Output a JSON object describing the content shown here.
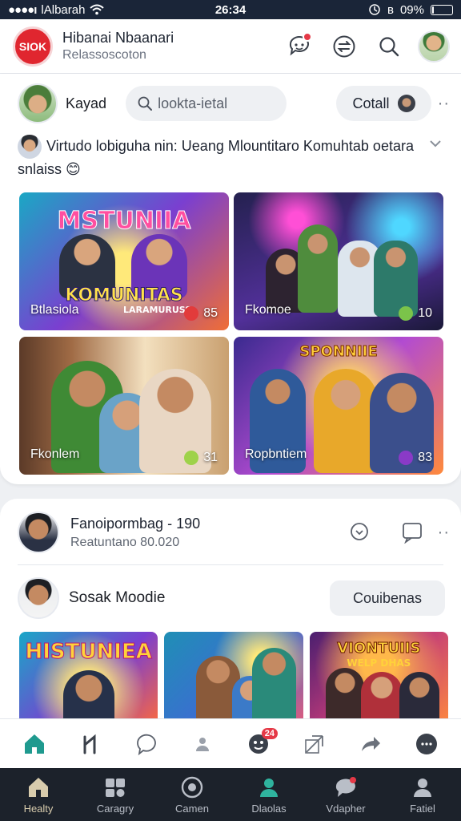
{
  "status_bar": {
    "carrier": "lAlbarah",
    "time": "26:34",
    "battery": "09%",
    "battery_fraction": 0.09
  },
  "app_header": {
    "logo_text": "SIOK",
    "title": "Hibanai Nbaanari",
    "subtitle": "Relassoscoton",
    "icons": [
      "chat-bot-icon",
      "swap-icon",
      "search-icon"
    ]
  },
  "composer": {
    "user_name": "Kayad",
    "search_placeholder": "lookta-ietal",
    "collect_button": "Cotall"
  },
  "post": {
    "title": "Virtudo lobiguha nin: Ueang Mlountitaro Komuhtab oetara snlaiss",
    "emoji": "😊",
    "tiles": [
      {
        "heading": "MSTUNIIA",
        "heading2": "KOMUNITAS",
        "caption": "LARAMURUSS",
        "label": "Btlasiola",
        "count": "85",
        "bubble_color": "#e23b3b"
      },
      {
        "label": "Fkomoe",
        "count": "10",
        "bubble_color": "#7bc34a"
      },
      {
        "label": "Fkonlem",
        "count": "31",
        "bubble_color": "#9ed24a"
      },
      {
        "heading": "SPONNIIE",
        "label": "Ropbntiem",
        "count": "83",
        "bubble_color": "#8a3ac7"
      }
    ]
  },
  "feed_item": {
    "title": "Fanoipormbag - 190",
    "subtitle": "Reatuntano 80.020"
  },
  "suggestion": {
    "name": "Sosak Moodie",
    "button": "Couibenas"
  },
  "thumbnails": [
    {
      "heading": "HISTUNIEA"
    },
    {
      "heading": ""
    },
    {
      "heading": "VIONTUIIS",
      "heading2": "WELP DHAS"
    }
  ],
  "action_bar": {
    "badge": "24"
  },
  "bottom_nav": [
    {
      "label": "Healty",
      "icon": "home-icon",
      "active": true
    },
    {
      "label": "Caragry",
      "icon": "category-icon",
      "active": false
    },
    {
      "label": "Camen",
      "icon": "camera-icon",
      "active": false
    },
    {
      "label": "Dlaolas",
      "icon": "people-icon",
      "active": false
    },
    {
      "label": "Vdapher",
      "icon": "chat-icon",
      "active": false
    },
    {
      "label": "Fatiel",
      "icon": "profile-icon",
      "active": false
    }
  ],
  "colors": {
    "accent": "#1f9a8f",
    "header_dark": "#1a2538",
    "nav_dark": "#1c222b",
    "logo_red": "#e0262f"
  }
}
